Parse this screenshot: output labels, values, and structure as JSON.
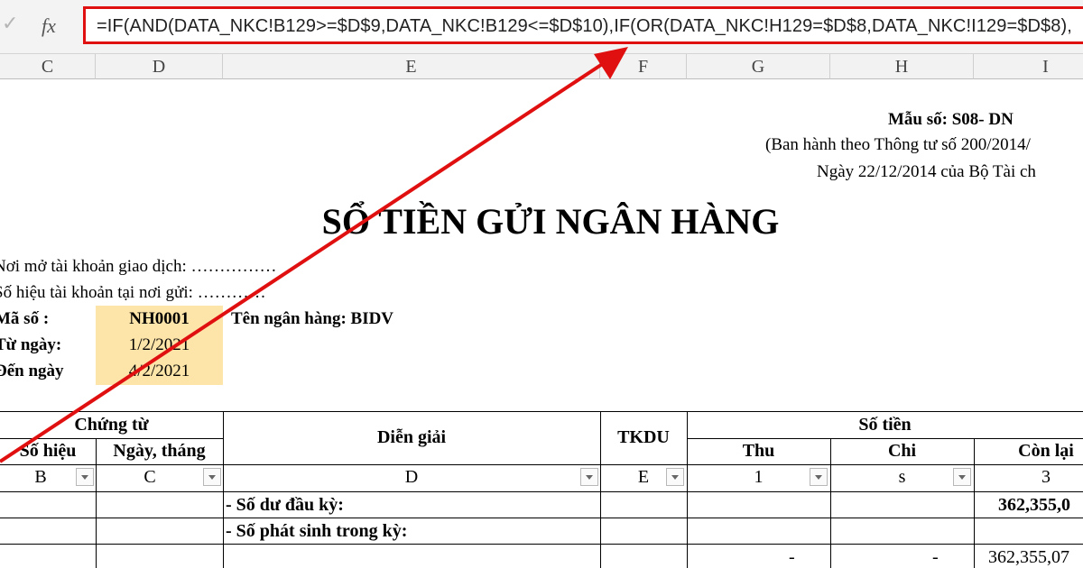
{
  "formula_bar": {
    "cancel_glyph": "✓",
    "fx_label": "fx",
    "formula": "=IF(AND(DATA_NKC!B129>=$D$9,DATA_NKC!B129<=$D$10),IF(OR(DATA_NKC!H129=$D$8,DATA_NKC!I129=$D$8),"
  },
  "columns": [
    "C",
    "D",
    "E",
    "F",
    "G",
    "H",
    "I"
  ],
  "header": {
    "form_no": "Mẫu số: S08- DN",
    "issued_by": "(Ban hành theo Thông tư số 200/2014/",
    "date_line": "Ngày 22/12/2014 của Bộ Tài ch"
  },
  "title": "SỔ TIỀN GỬI NGÂN HÀNG",
  "info": {
    "place": "Nơi mở tài khoản giao dịch: ……………",
    "account_no": "Số hiệu tài khoản tại nơi gửi: …………",
    "code_label": "Mã số :",
    "code_value": "NH0001",
    "bank_label": "Tên ngân hàng: BIDV",
    "from_label": "Từ ngày:",
    "from_value": "1/2/2021",
    "to_label": "Đến ngày",
    "to_value": "4/2/2021"
  },
  "table": {
    "chung_tu": "Chứng từ",
    "so_hieu": "Số hiệu",
    "ngay_thang": "Ngày, tháng",
    "dien_giai": "Diễn giải",
    "tkdu": "TKDU",
    "so_tien": "Số tiền",
    "thu": "Thu",
    "chi": "Chi",
    "con_lai": "Còn lại",
    "filters": [
      "B",
      "C",
      "D",
      "E",
      "1",
      "s",
      "3"
    ],
    "rows": [
      {
        "dien_giai": "- Số dư đầu kỳ:",
        "thu": "",
        "chi": "",
        "con_lai": "362,355,0"
      },
      {
        "dien_giai": "- Số phát sinh trong kỳ:",
        "thu": "",
        "chi": "",
        "con_lai": ""
      },
      {
        "dien_giai": "",
        "thu": "-",
        "chi": "-",
        "con_lai": "362,355,07"
      }
    ]
  },
  "colors": {
    "highlight": "#fde4a8",
    "annotation_red": "#e01010"
  }
}
